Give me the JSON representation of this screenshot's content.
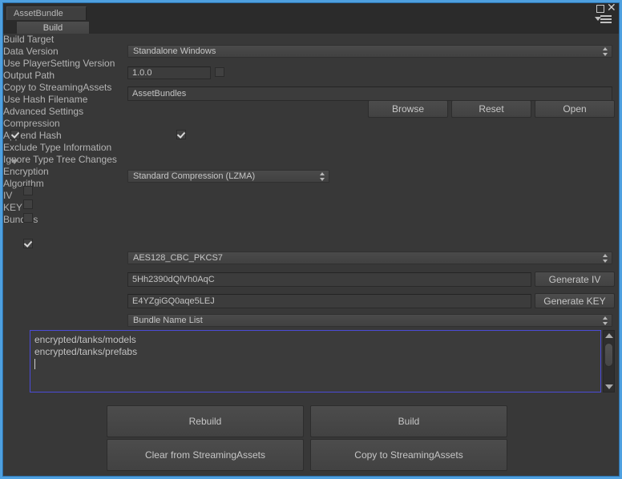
{
  "window": {
    "tab_label": "AssetBundle",
    "subtab_label": "Build",
    "accent_color": "#4ea0e0",
    "controls": {
      "maximize": "maximize-icon",
      "close": "close-icon",
      "menu": "hamburger-menu-icon",
      "menu_caret": "chevron-down-icon"
    }
  },
  "fields": {
    "build_target": {
      "label": "Build Target",
      "value": "Standalone Windows"
    },
    "data_version": {
      "label": "Data Version",
      "value": "1.0.0",
      "use_playersetting": {
        "label": "Use PlayerSetting Version",
        "checked": false
      }
    },
    "output_path": {
      "label": "Output Path",
      "value": "AssetBundles"
    }
  },
  "path_buttons": [
    {
      "label": "Browse"
    },
    {
      "label": "Reset"
    },
    {
      "label": "Open"
    }
  ],
  "toggles": {
    "copy_to_streaming_assets": {
      "label": "Copy to StreamingAssets",
      "checked": true
    },
    "use_hash_filename": {
      "label": "Use Hash Filename",
      "checked": true
    }
  },
  "advanced": {
    "header": "Advanced Settings",
    "expanded": true,
    "compression": {
      "label": "Compression",
      "value": "Standard Compression (LZMA)"
    },
    "options": [
      {
        "label": "Append Hash",
        "checked": false
      },
      {
        "label": "Exclude Type Information",
        "checked": false
      },
      {
        "label": "Ignore Type Tree Changes",
        "checked": false
      }
    ]
  },
  "encryption": {
    "header": "Encryption",
    "checked": true,
    "algorithm": {
      "label": "Algorithm",
      "value": "AES128_CBC_PKCS7"
    },
    "iv": {
      "label": "IV",
      "value": "5Hh2390dQlVh0AqC",
      "button": "Generate IV"
    },
    "key": {
      "label": "KEY",
      "value": "E4YZgiGQ0aqe5LEJ",
      "button": "Generate KEY"
    },
    "bundles": {
      "label": "Bundles",
      "value": "Bundle Name List",
      "lines": [
        "encrypted/tanks/models",
        "encrypted/tanks/prefabs"
      ]
    }
  },
  "actions": {
    "rebuild": "Rebuild",
    "build": "Build",
    "clear_from_streaming_assets": "Clear from StreamingAssets",
    "copy_to_streaming_assets": "Copy to StreamingAssets"
  }
}
